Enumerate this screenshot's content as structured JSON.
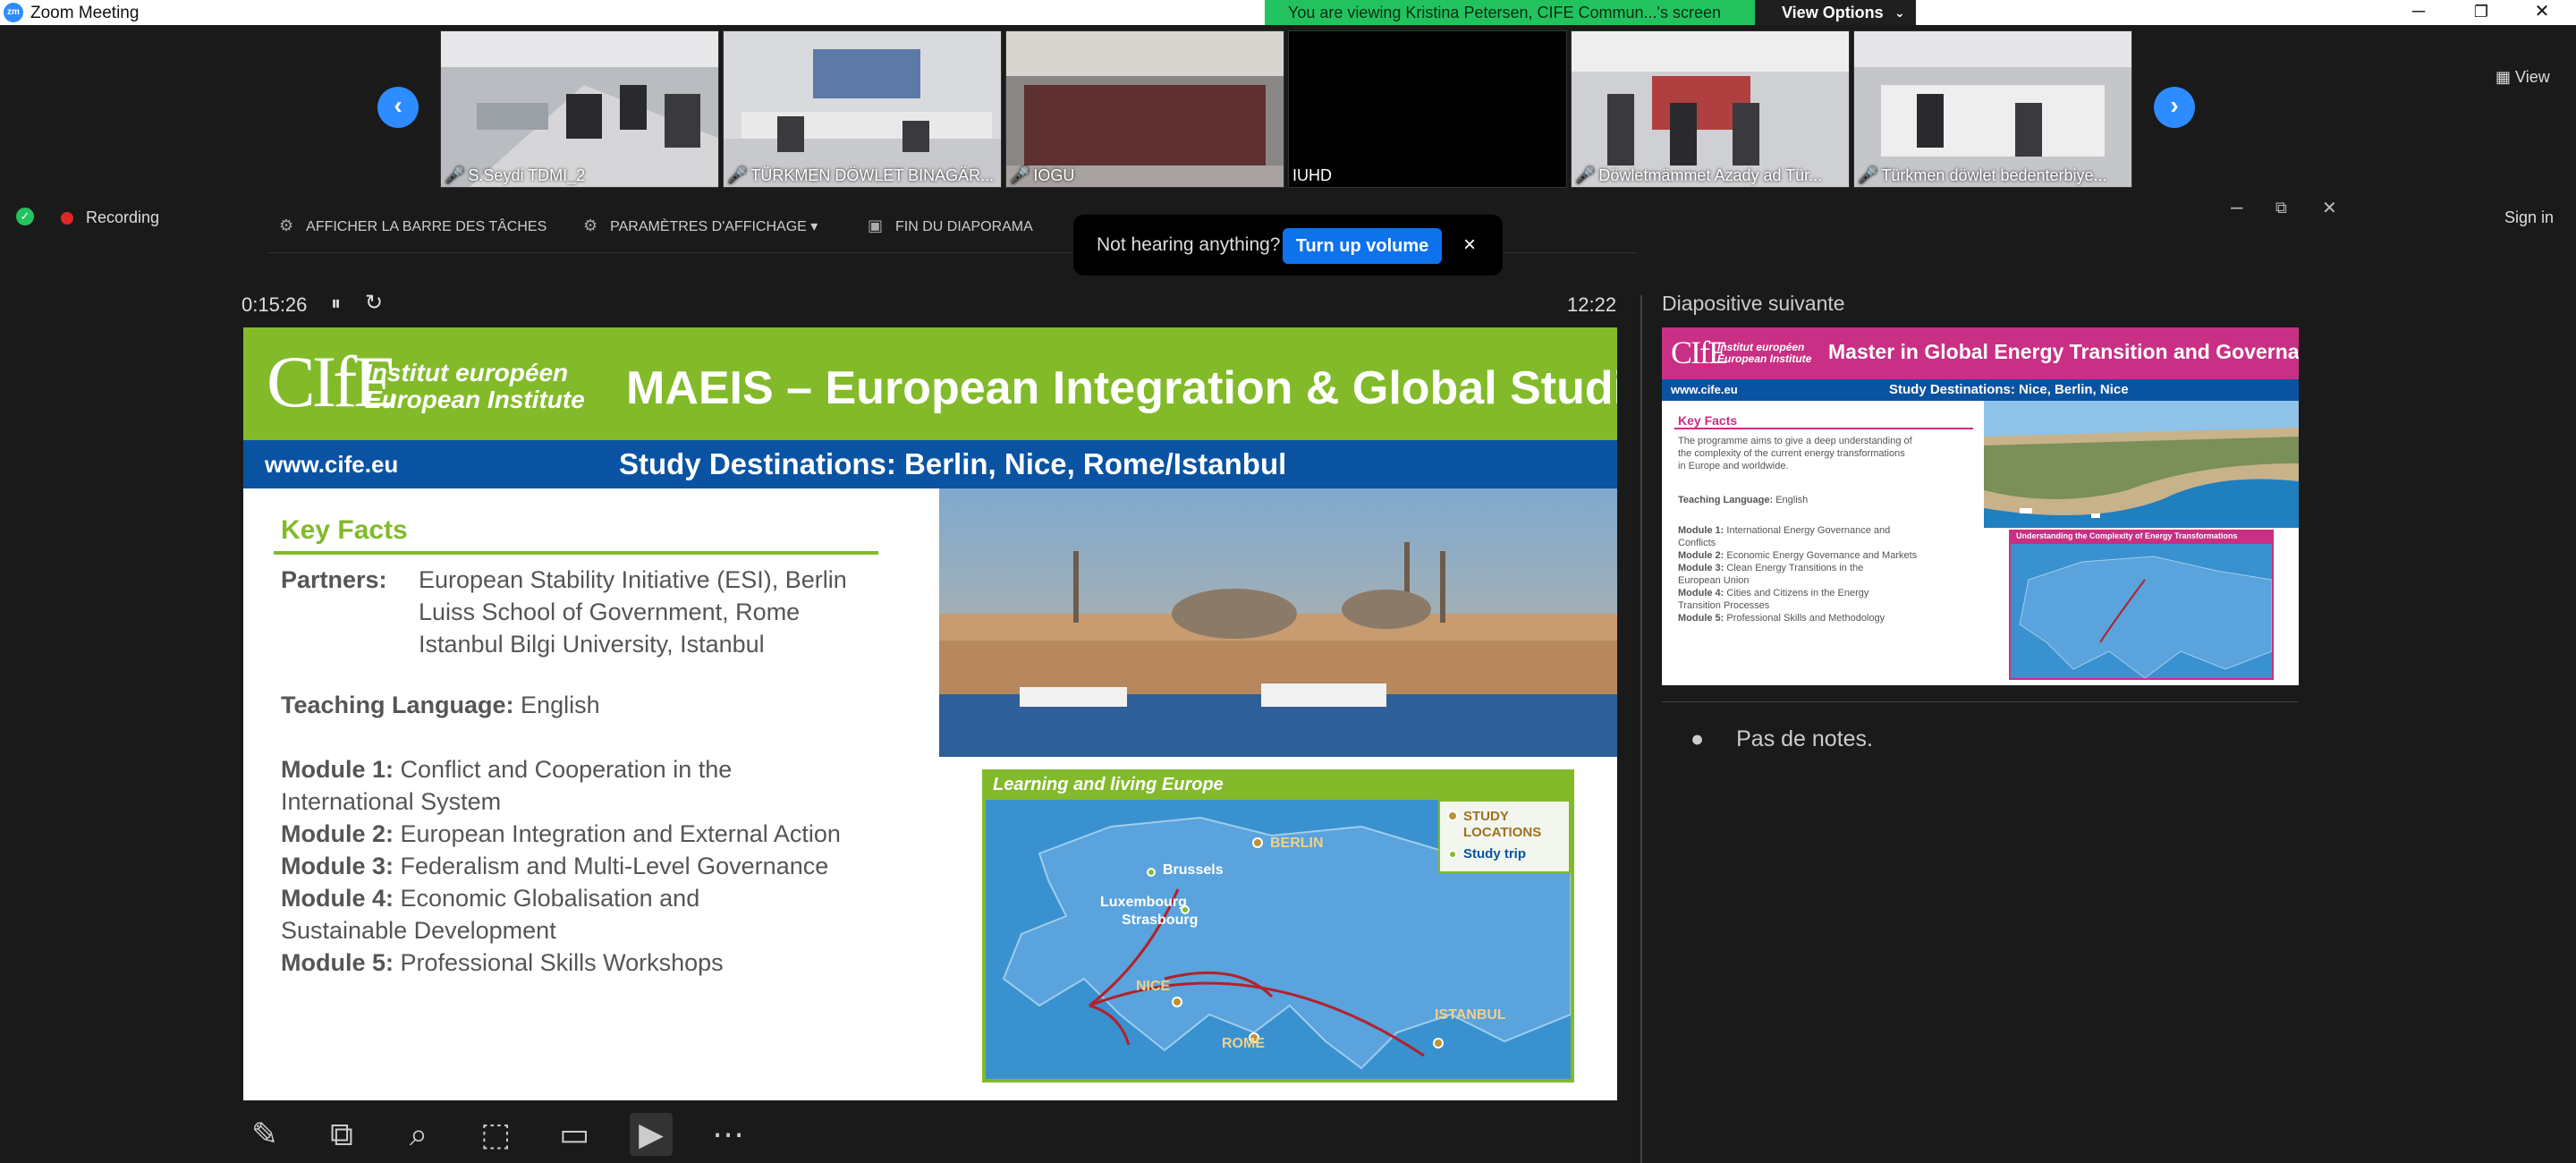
{
  "window": {
    "title": "Zoom Meeting",
    "minimize": "─",
    "restore": "❐",
    "close": "✕"
  },
  "share_banner": {
    "text": "You are viewing Kristina Petersen, CIFE Commun...'s screen",
    "view_options": "View Options"
  },
  "gallery": {
    "participants": [
      "S.Seydi TDMI_2",
      "TÜRKMEN DÖWLET BINAGÄR...",
      "IOGU",
      "IUHD",
      "Döwletmämmet Azady ad Tür...",
      "Türkmen döwlet bedenterbiye..."
    ],
    "view_label": "View"
  },
  "status": {
    "recording": "Recording",
    "sign_in": "Sign in"
  },
  "presenter_toolbar": {
    "show_taskbar": "AFFICHER LA BARRE DES TÂCHES",
    "display_settings": "PARAMÈTRES D'AFFICHAGE ▾",
    "end_slideshow": "FIN DU DIAPORAMA"
  },
  "toast": {
    "message": "Not hearing anything?",
    "button": "Turn up volume",
    "close": "×"
  },
  "presenter": {
    "elapsed": "0:15:26",
    "clock": "12:22",
    "next_slide_label": "Diapositive suivante",
    "notes": "Pas de notes."
  },
  "slide": {
    "logo": "CIfE",
    "institute_fr": "Institut européen",
    "institute_en": "European Institute",
    "title": "MAEIS – European Integration & Global Studies",
    "url": "www.cife.eu",
    "subtitle": "Study Destinations: Berlin, Nice, Rome/Istanbul",
    "key_facts": "Key Facts",
    "partners_label": "Partners:",
    "partners": [
      "European Stability Initiative (ESI), Berlin",
      "Luiss School of Government, Rome",
      "Istanbul Bilgi University, Istanbul"
    ],
    "teaching_label": "Teaching Language:",
    "teaching_value": "English",
    "modules": [
      {
        "label": "Module 1:",
        "text": "Conflict and Cooperation in the",
        "text2": "International System"
      },
      {
        "label": "Module 2:",
        "text": "European Integration and External Action"
      },
      {
        "label": "Module 3:",
        "text": "Federalism and Multi-Level Governance"
      },
      {
        "label": "Module 4:",
        "text": "Economic Globalisation and",
        "text2": "Sustainable Development"
      },
      {
        "label": "Module 5:",
        "text": "Professional Skills Workshops"
      }
    ],
    "map": {
      "title": "Learning and living Europe",
      "legend_study": "STUDY",
      "legend_locations": "LOCATIONS",
      "legend_trip": "Study trip",
      "cities": {
        "berlin": "BERLIN",
        "brussels": "Brussels",
        "luxembourg": "Luxembourg",
        "strasbourg": "Strasbourg",
        "nice": "NICE",
        "rome": "ROME",
        "istanbul": "ISTANBUL"
      }
    }
  },
  "next_slide": {
    "logo": "CIfE",
    "institute_fr": "Institut européen",
    "institute_en": "European Institute",
    "title": "Master in Global Energy Transition and Governance",
    "url": "www.cife.eu",
    "subtitle": "Study Destinations: Nice, Berlin, Nice",
    "key_facts": "Key Facts",
    "intro": [
      "The programme aims to give a deep understanding of",
      "the complexity of the current energy transformations",
      "in Europe and worldwide."
    ],
    "teaching_label": "Teaching Language:",
    "teaching_value": "English",
    "modules": [
      {
        "label": "Module 1:",
        "text": "International Energy Governance and",
        "text2": "Conflicts"
      },
      {
        "label": "Module 2:",
        "text": "Economic Energy Governance and Markets"
      },
      {
        "label": "Module 3:",
        "text": "Clean Energy Transitions in the",
        "text2": "European Union"
      },
      {
        "label": "Module 4:",
        "text": "Cities and Citizens in the Energy",
        "text2": "Transition Processes"
      },
      {
        "label": "Module 5:",
        "text": "Professional Skills and Methodology"
      }
    ],
    "map_title": "Understanding the Complexity of Energy Transformations"
  },
  "colors": {
    "zoom_blue": "#2d8cff",
    "cife_green": "#82ba2a",
    "cife_blue": "#0a53a2",
    "cife_pink": "#c92f84",
    "banner_green": "#22c35e"
  },
  "icons": {
    "bottom_toolbar": [
      "pen-icon",
      "layout-icon",
      "magnifier-icon",
      "pointer-icon",
      "subtitles-icon",
      "camera-icon",
      "more-icon"
    ]
  }
}
